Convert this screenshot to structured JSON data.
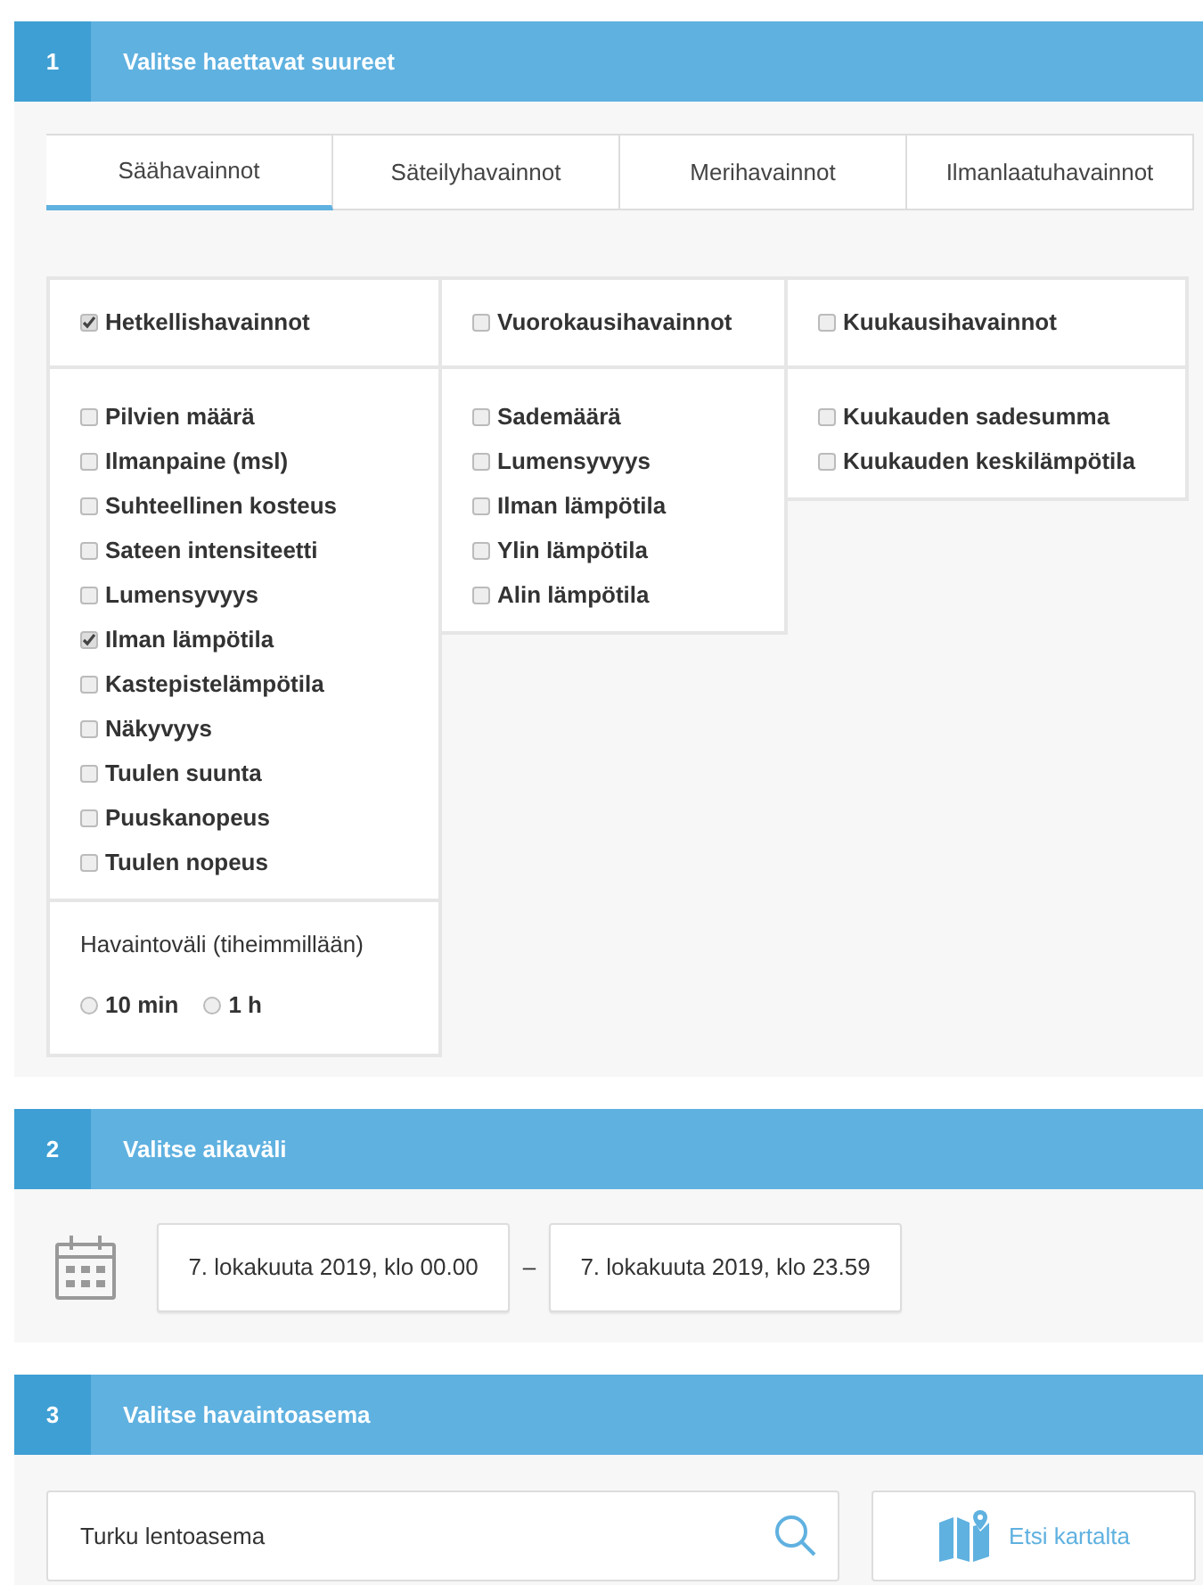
{
  "step1": {
    "number": "1",
    "title": "Valitse haettavat suureet",
    "tabs": [
      {
        "label": "Säähavainnot",
        "selected": true
      },
      {
        "label": "Säteilyhavainnot",
        "selected": false
      },
      {
        "label": "Merihavainnot",
        "selected": false
      },
      {
        "label": "Ilmanlaatuhavainnot",
        "selected": false
      }
    ],
    "groups": [
      {
        "label": "Hetkellishavainnot",
        "checked": true,
        "items": [
          {
            "label": "Pilvien määrä",
            "checked": false
          },
          {
            "label": "Ilmanpaine (msl)",
            "checked": false
          },
          {
            "label": "Suhteellinen kosteus",
            "checked": false
          },
          {
            "label": "Sateen intensiteetti",
            "checked": false
          },
          {
            "label": "Lumensyvyys",
            "checked": false
          },
          {
            "label": "Ilman lämpötila",
            "checked": true
          },
          {
            "label": "Kastepistelämpötila",
            "checked": false
          },
          {
            "label": "Näkyvyys",
            "checked": false
          },
          {
            "label": "Tuulen suunta",
            "checked": false
          },
          {
            "label": "Puuskanopeus",
            "checked": false
          },
          {
            "label": "Tuulen nopeus",
            "checked": false
          }
        ],
        "interval": {
          "label": "Havaintoväli (tiheimmillään)",
          "options": [
            {
              "label": "10 min",
              "selected": false
            },
            {
              "label": "1 h",
              "selected": false
            }
          ]
        }
      },
      {
        "label": "Vuorokausihavainnot",
        "checked": false,
        "items": [
          {
            "label": "Sademäärä",
            "checked": false
          },
          {
            "label": "Lumensyvyys",
            "checked": false
          },
          {
            "label": "Ilman lämpötila",
            "checked": false
          },
          {
            "label": "Ylin lämpötila",
            "checked": false
          },
          {
            "label": "Alin lämpötila",
            "checked": false
          }
        ]
      },
      {
        "label": "Kuukausihavainnot",
        "checked": false,
        "items": [
          {
            "label": "Kuukauden sadesumma",
            "checked": false
          },
          {
            "label": "Kuukauden keskilämpötila",
            "checked": false
          }
        ]
      }
    ]
  },
  "step2": {
    "number": "2",
    "title": "Valitse aikaväli",
    "start": "7. lokakuuta 2019, klo 00.00",
    "separator": "–",
    "end": "7. lokakuuta 2019, klo 23.59"
  },
  "step3": {
    "number": "3",
    "title": "Valitse havaintoasema",
    "search_value": "Turku lentoasema",
    "map_button": "Etsi kartalta"
  }
}
